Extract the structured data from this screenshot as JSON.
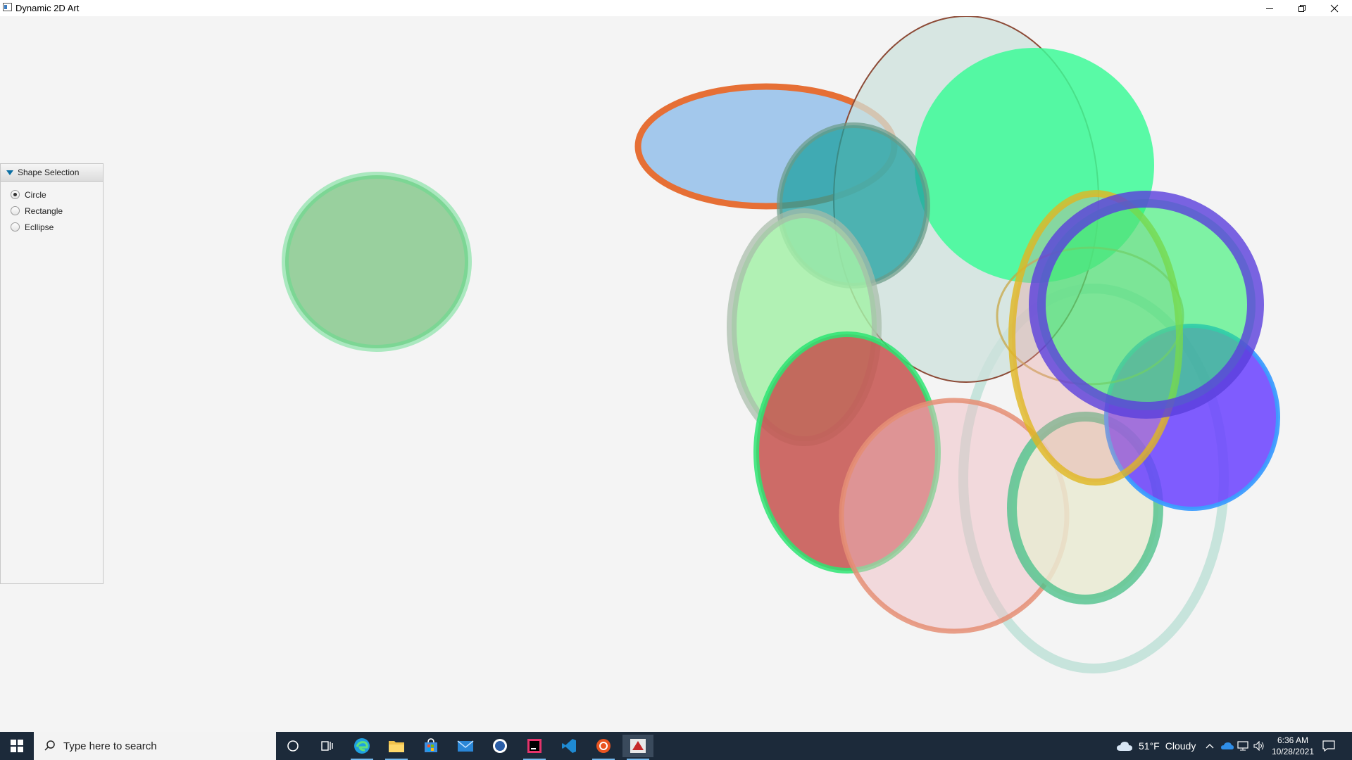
{
  "window": {
    "title": "Dynamic 2D Art"
  },
  "panel": {
    "header": "Shape Selection",
    "options": [
      {
        "label": "Circle",
        "selected": true
      },
      {
        "label": "Rectangle",
        "selected": false
      },
      {
        "label": "Ecllipse",
        "selected": false
      }
    ]
  },
  "taskbar": {
    "search_placeholder": "Type here to search",
    "apps": [
      "cortana-icon",
      "task-view-icon",
      "edge-icon",
      "file-explorer-icon",
      "store-icon",
      "mail-icon",
      "word-icon",
      "intellij-icon",
      "vscode-icon",
      "ubuntu-icon",
      "java-app-icon"
    ],
    "weather": {
      "temp": "51°F",
      "condition": "Cloudy"
    },
    "time": "6:36 AM",
    "date": "10/28/2021"
  },
  "colors": {
    "taskbar": "#1c2a3a",
    "panel_arrow": "#0b6fa4"
  }
}
